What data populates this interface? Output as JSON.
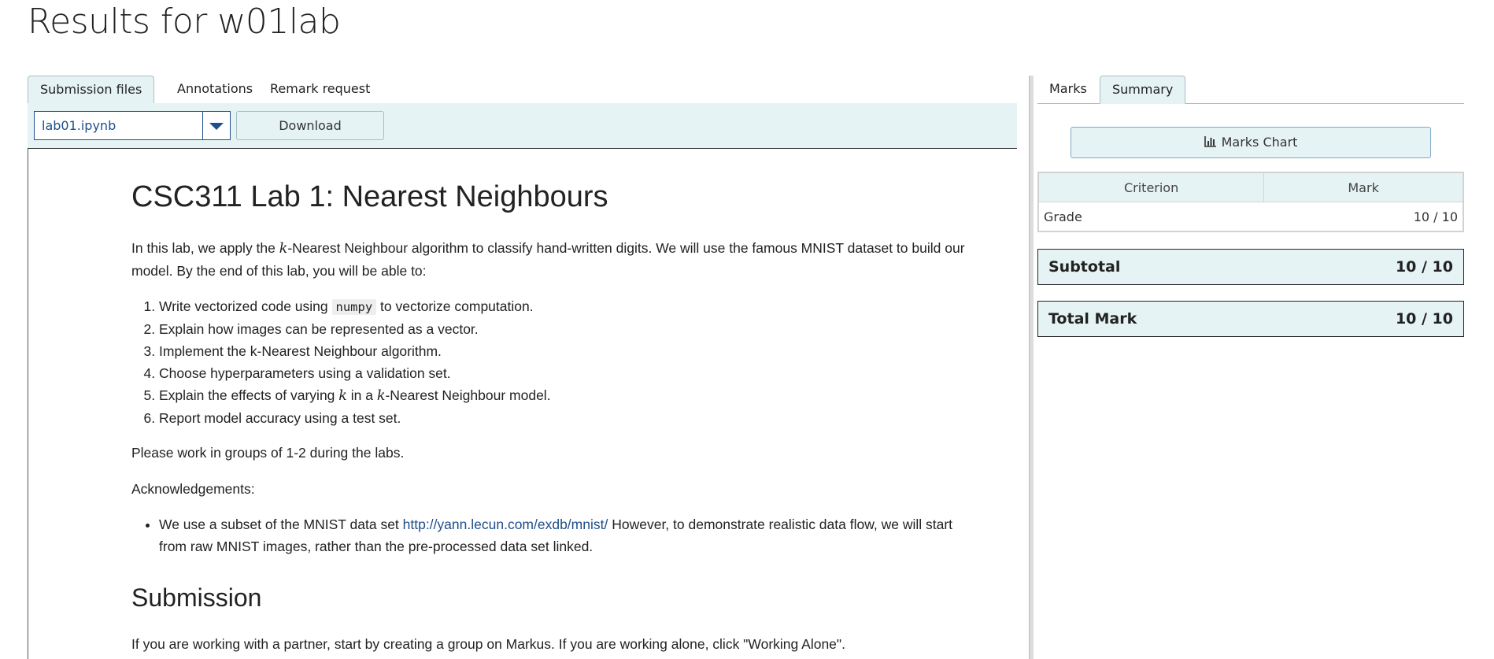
{
  "page": {
    "title": "Results for w01lab"
  },
  "left_tabs": [
    {
      "label": "Submission files",
      "active": true
    },
    {
      "label": "Annotations",
      "active": false
    },
    {
      "label": "Remark request",
      "active": false
    }
  ],
  "toolbar": {
    "selected_file": "lab01.ipynb",
    "download_label": "Download"
  },
  "document": {
    "title": "CSC311 Lab 1: Nearest Neighbours",
    "intro_before_k": "In this lab, we apply the ",
    "k": "k",
    "intro_after_k": "-Nearest Neighbour algorithm to classify hand-written digits. We will use the famous MNIST dataset to build our model. By the end of this lab, you will be able to:",
    "objectives": {
      "item1_before": "Write vectorized code using ",
      "item1_code": "numpy",
      "item1_after": " to vectorize computation.",
      "item2": "Explain how images can be represented as a vector.",
      "item3": "Implement the k-Nearest Neighbour algorithm.",
      "item4": "Choose hyperparameters using a validation set.",
      "item5_a": "Explain the effects of varying ",
      "item5_b": " in a ",
      "item5_c": "-Nearest Neighbour model.",
      "item6": "Report model accuracy using a test set."
    },
    "groups_text": "Please work in groups of 1-2 during the labs.",
    "acknowledgements_label": "Acknowledgements:",
    "ack_before_link": "We use a subset of the MNIST data set ",
    "ack_link": "http://yann.lecun.com/exdb/mnist/",
    "ack_after_link": " However, to demonstrate realistic data flow, we will start from raw MNIST images, rather than the pre-processed data set linked.",
    "submission_heading": "Submission",
    "partner_text": "If you are working with a partner, start by creating a group on Markus. If you are working alone, click \"Working Alone\"."
  },
  "right_tabs": [
    {
      "label": "Marks",
      "active": false
    },
    {
      "label": "Summary",
      "active": true
    }
  ],
  "summary": {
    "chart_button": "Marks Chart",
    "headers": {
      "criterion": "Criterion",
      "mark": "Mark"
    },
    "rows": [
      {
        "criterion": "Grade",
        "mark": "10 / 10"
      }
    ],
    "subtotal_label": "Subtotal",
    "subtotal_value": "10 / 10",
    "total_label": "Total Mark",
    "total_value": "10 / 10"
  },
  "colors": {
    "accent_bg": "#e6f3f4",
    "link": "#1f4e8c",
    "border": "#a7bfc2"
  },
  "icons": {
    "chart": "bar-chart-icon",
    "dropdown": "caret-down-icon"
  }
}
